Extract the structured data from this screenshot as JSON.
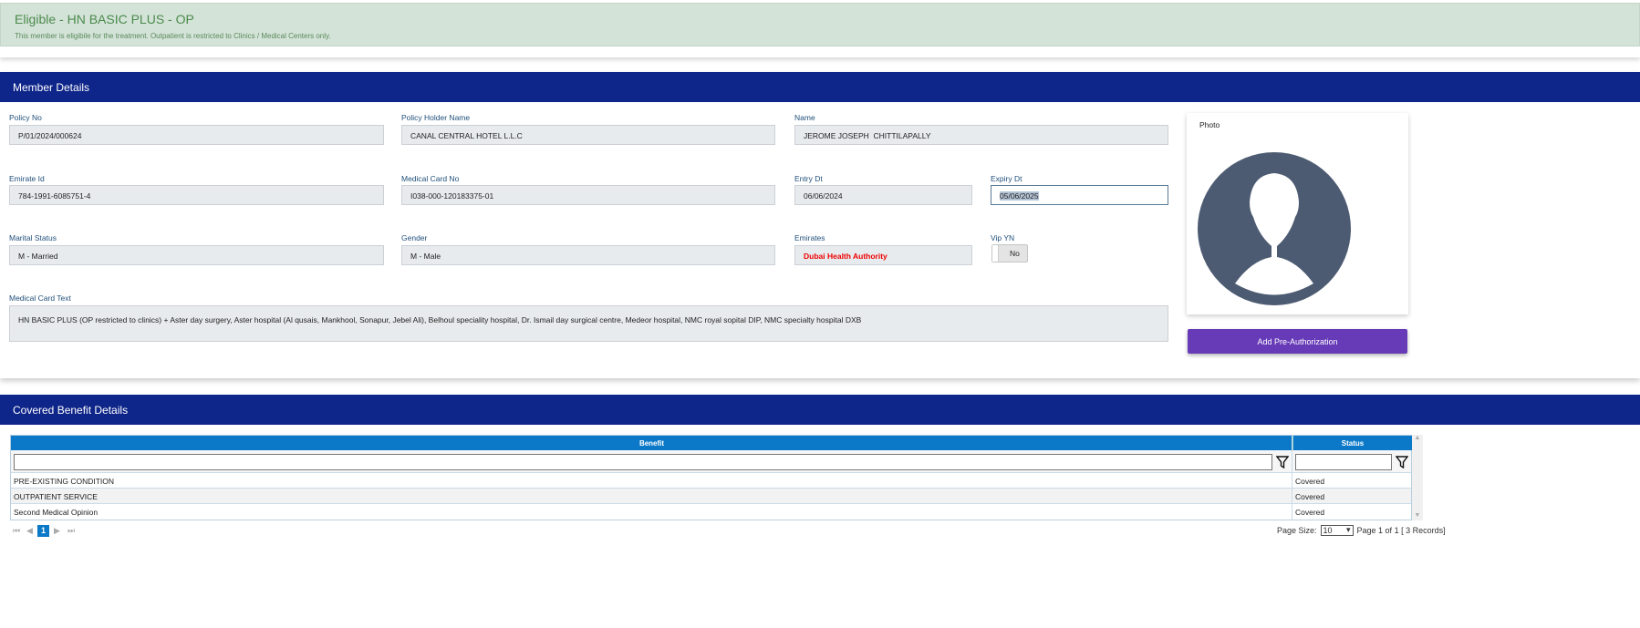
{
  "banner": {
    "title": "Eligible - HN BASIC PLUS - OP",
    "message": "This member is eligibile for the treatment. Outpatient is restricted to Clinics / Medical Centers only."
  },
  "member": {
    "header": "Member Details",
    "fields": {
      "policy_no": {
        "label": "Policy No",
        "value": "P/01/2024/000624"
      },
      "policy_holder": {
        "label": "Policy Holder Name",
        "value": "CANAL CENTRAL HOTEL L.L.C"
      },
      "name": {
        "label": "Name",
        "value": "JEROME JOSEPH  CHITTILAPALLY"
      },
      "emirate_id": {
        "label": "Emirate Id",
        "value": "784-1991-6085751-4"
      },
      "medical_card_no": {
        "label": "Medical Card No",
        "value": "I038-000-120183375-01"
      },
      "entry_dt": {
        "label": "Entry Dt",
        "value": "06/06/2024"
      },
      "expiry_dt": {
        "label": "Expiry Dt",
        "value": "05/06/2025"
      },
      "marital_status": {
        "label": "Marital Status",
        "value": "M - Married"
      },
      "gender": {
        "label": "Gender",
        "value": "M - Male"
      },
      "emirates": {
        "label": "Emirates",
        "value": "Dubai Health Authority"
      },
      "vip": {
        "label": "Vip YN",
        "value": "No"
      },
      "card_text": {
        "label": "Medical Card Text",
        "value": "HN BASIC PLUS (OP restricted to clinics) + Aster day surgery, Aster hospital (Al qusais, Mankhool, Sonapur, Jebel Ali), Belhoul speciality hospital, Dr. Ismail day surgical centre, Medeor hospital, NMC royal sopital DIP,  NMC specialty hospital DXB"
      }
    },
    "photo_label": "Photo",
    "add_preauth": "Add Pre-Authorization"
  },
  "benefits": {
    "header": "Covered Benefit Details",
    "columns": [
      "Benefit",
      "Status"
    ],
    "rows": [
      {
        "benefit": "PRE-EXISTING CONDITION",
        "status": "Covered"
      },
      {
        "benefit": "OUTPATIENT SERVICE",
        "status": "Covered"
      },
      {
        "benefit": "Second Medical Opinion",
        "status": "Covered"
      }
    ],
    "pager": {
      "current_page": "1",
      "page_size_label": "Page Size:",
      "page_size": "10",
      "summary": "Page 1 of 1 [ 3 Records]"
    }
  },
  "colors": {
    "header": "#0e2589",
    "button": "#673ab7",
    "grid_header": "#0b79c8"
  }
}
